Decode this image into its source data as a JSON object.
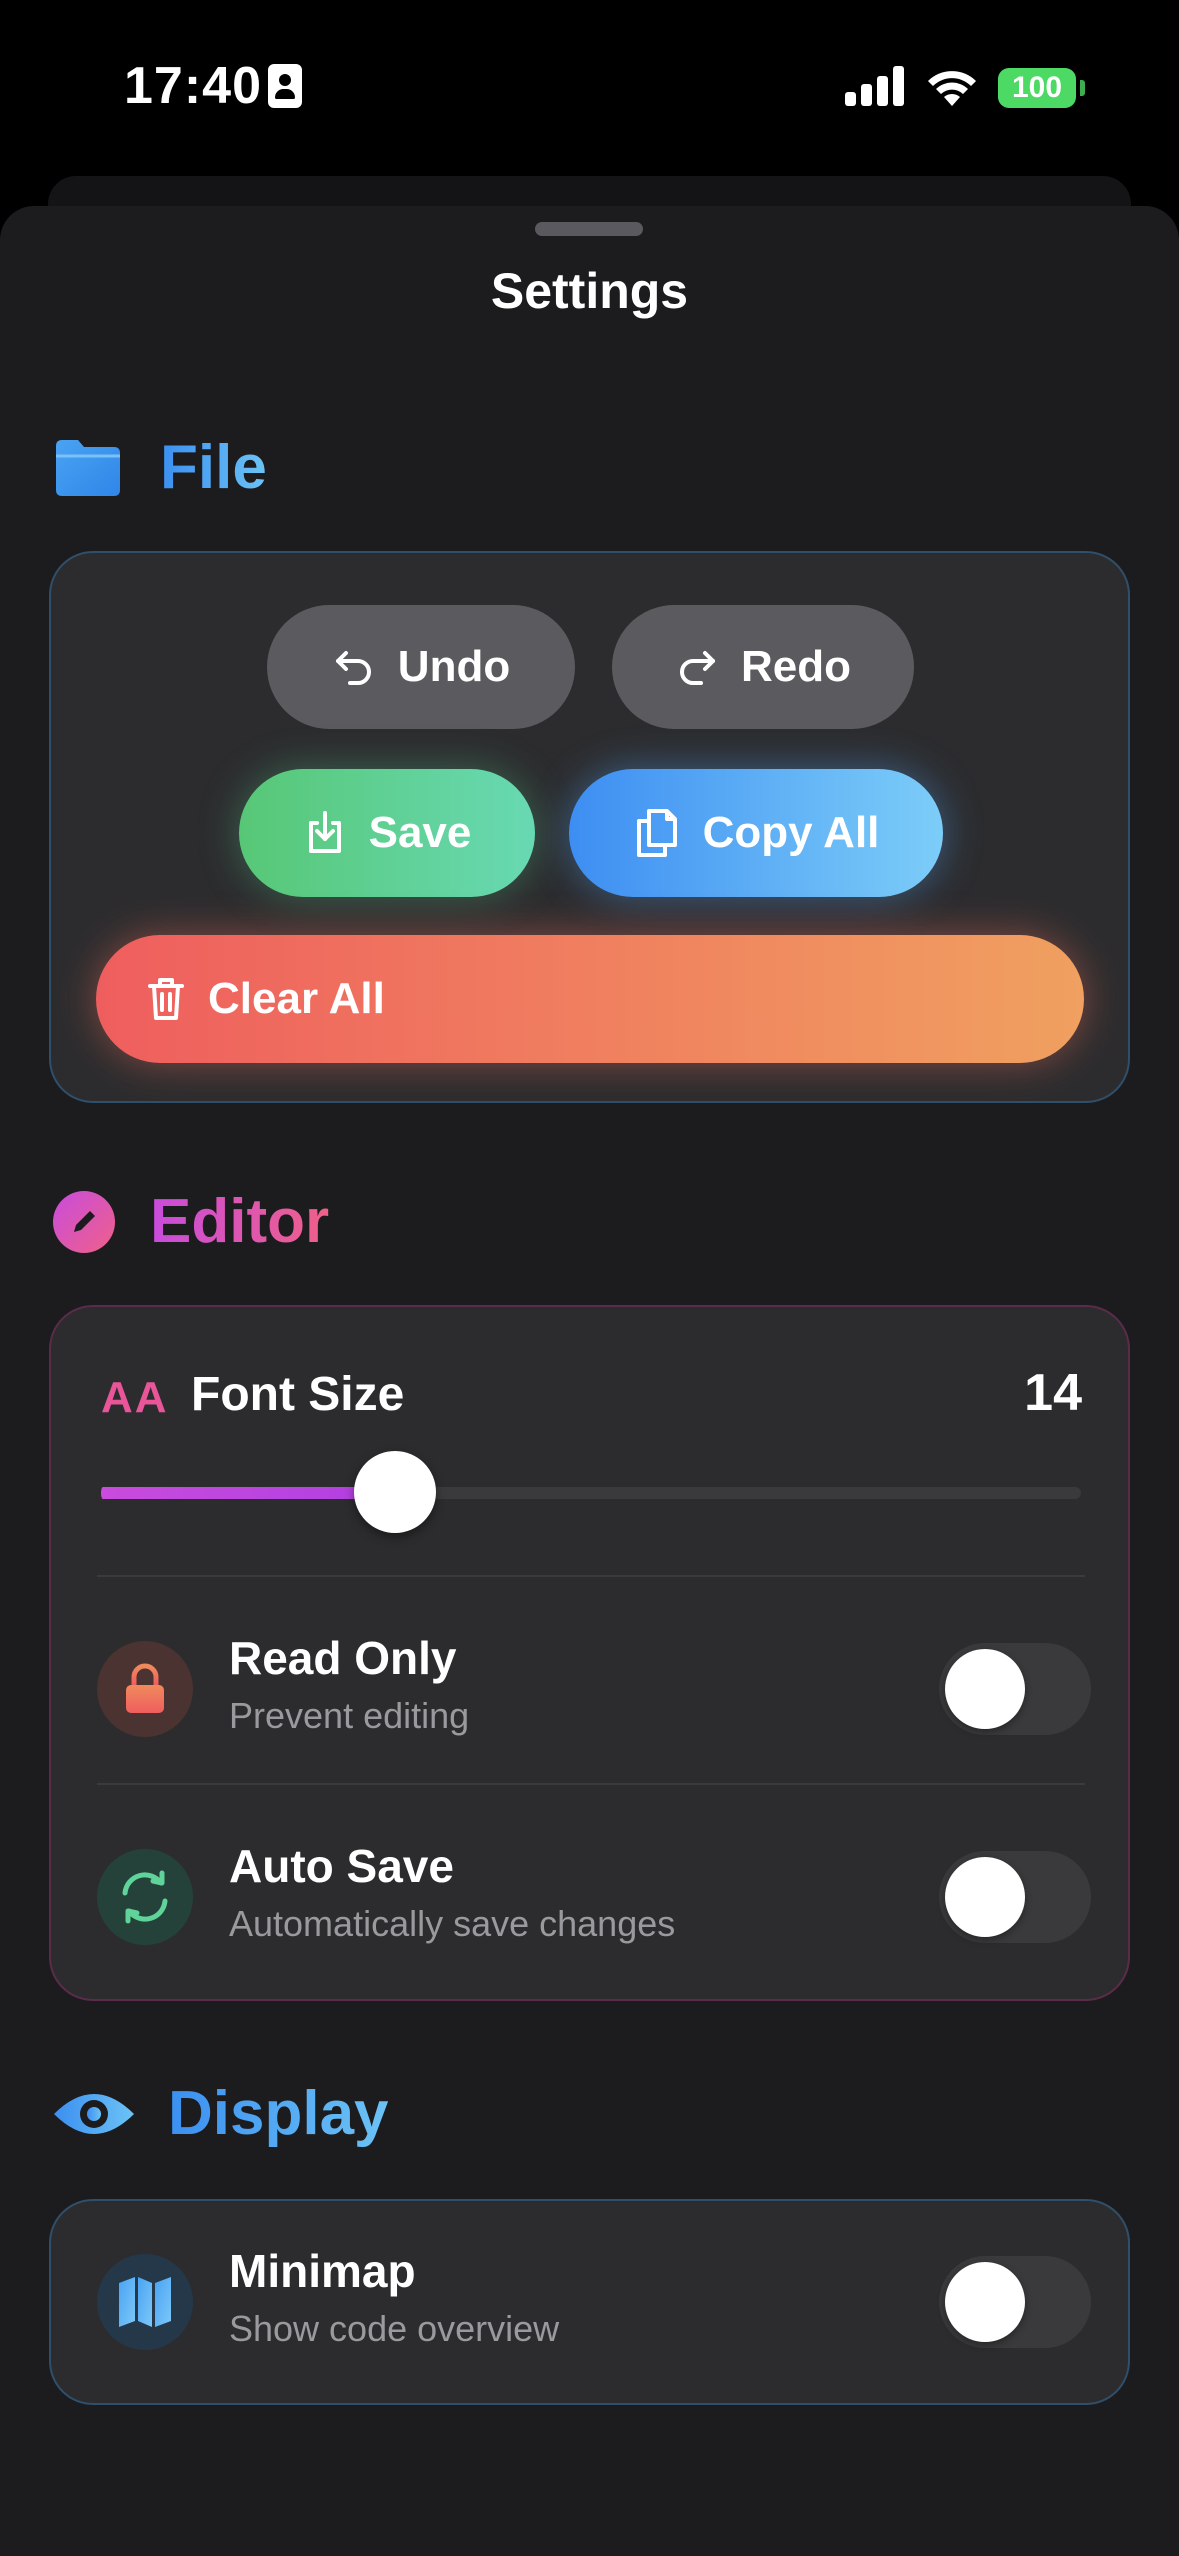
{
  "status_bar": {
    "time": "17:40",
    "battery": "100"
  },
  "sheet": {
    "title": "Settings"
  },
  "file": {
    "title": "File",
    "undo_label": "Undo",
    "redo_label": "Redo",
    "save_label": "Save",
    "copy_all_label": "Copy All",
    "clear_all_label": "Clear All"
  },
  "editor": {
    "title": "Editor",
    "font_size_icon_text": "AA",
    "font_size_label": "Font Size",
    "font_size_value": "14",
    "font_size_slider_fraction": 0.3,
    "read_only": {
      "title": "Read Only",
      "subtitle": "Prevent editing",
      "enabled": false
    },
    "auto_save": {
      "title": "Auto Save",
      "subtitle": "Automatically save changes",
      "enabled": false
    }
  },
  "display": {
    "title": "Display",
    "minimap": {
      "title": "Minimap",
      "subtitle": "Show code overview",
      "enabled": false
    }
  },
  "colors": {
    "background": "#1c1c1e",
    "card": "#2c2c2e",
    "accent_blue": "#3b8ff0",
    "accent_pink": "#c84cdd",
    "save_green": "#57c776",
    "clear_red": "#ef5e5e"
  },
  "icons": {
    "file_section": "folder-icon",
    "editor_section": "pencil-icon",
    "display_section": "eye-icon",
    "undo": "undo-arrow-icon",
    "redo": "redo-arrow-icon",
    "save": "download-tray-icon",
    "copy_all": "copy-documents-icon",
    "clear_all": "trash-icon",
    "read_only": "lock-icon",
    "auto_save": "sync-arrows-icon",
    "minimap": "map-icon"
  }
}
